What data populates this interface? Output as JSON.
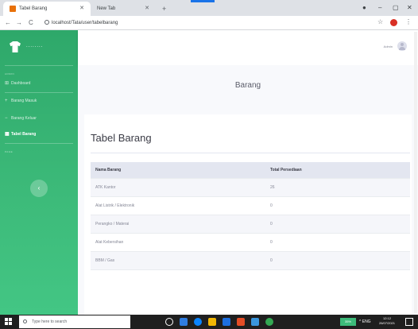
{
  "browser": {
    "tabs": [
      {
        "title": "Tabel Barang",
        "active": true
      },
      {
        "title": "New Tab",
        "active": false
      }
    ],
    "new_tab": "+",
    "url": "localhost/Tata/user/tabelbarang",
    "controls": {
      "minimize": "–",
      "maximize": "▢",
      "close": "✕"
    },
    "nav": {
      "back": "←",
      "forward": "→",
      "reload": "C"
    }
  },
  "sidebar": {
    "brand": "........",
    "heading_1": "ADMIN",
    "heading_2": "PAGE",
    "items": [
      {
        "label": "Dashboard",
        "icon": "⊞"
      },
      {
        "label": "Barang Masuk",
        "icon": "+"
      },
      {
        "label": "Barang Keluar",
        "icon": "−"
      },
      {
        "label": "Tabel Barang",
        "icon": "▦"
      }
    ],
    "toggle": "‹"
  },
  "topbar": {
    "user_name": "Admin"
  },
  "main": {
    "page_title": "Barang",
    "card_title": "Tabel Barang",
    "table": {
      "headers": [
        "Nama Barang",
        "Total Persediaan"
      ],
      "rows": [
        [
          "ATK Kantor",
          "26"
        ],
        [
          "Alat Listrik / Elektronik",
          "0"
        ],
        [
          "Perangko / Materai",
          "0"
        ],
        [
          "Alat Kebersihan",
          "0"
        ],
        [
          "BBM / Gas",
          "0"
        ]
      ]
    }
  },
  "taskbar": {
    "search_placeholder": "Type here to search",
    "tray_badge": "35%",
    "tray_lang": "^ ENG",
    "time": "12:12",
    "date": "26/07/2021"
  },
  "colors": {
    "sidebar": "#3dbb7a",
    "accent": "#1a73e8"
  }
}
